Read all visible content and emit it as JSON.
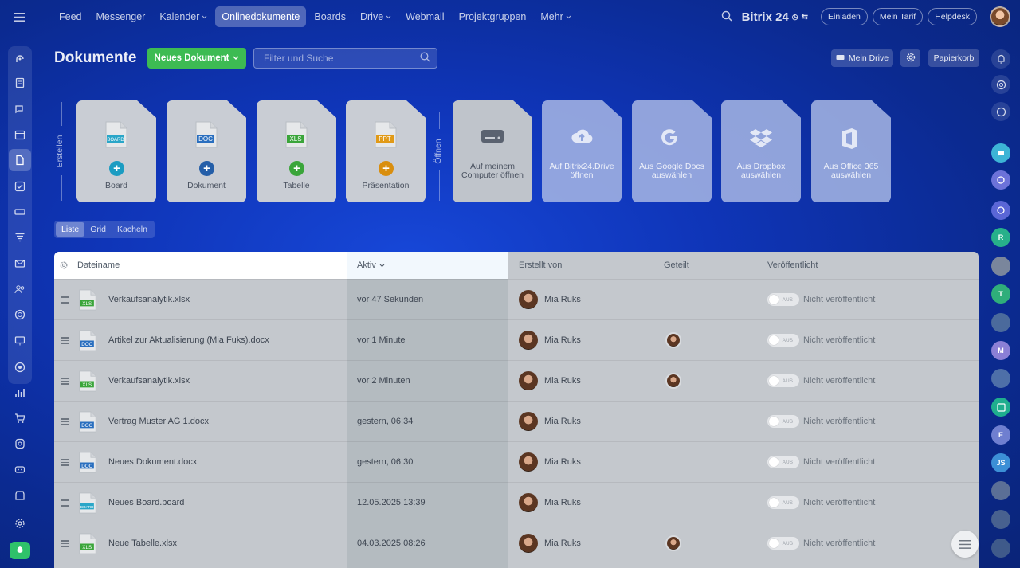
{
  "topbar": {
    "nav": [
      {
        "label": "Feed",
        "active": false,
        "dropdown": false
      },
      {
        "label": "Messenger",
        "active": false,
        "dropdown": false
      },
      {
        "label": "Kalender",
        "active": false,
        "dropdown": true
      },
      {
        "label": "Onlinedokumente",
        "active": true,
        "dropdown": false
      },
      {
        "label": "Boards",
        "active": false,
        "dropdown": false
      },
      {
        "label": "Drive",
        "active": false,
        "dropdown": true
      },
      {
        "label": "Webmail",
        "active": false,
        "dropdown": false
      },
      {
        "label": "Projektgruppen",
        "active": false,
        "dropdown": false
      },
      {
        "label": "Mehr",
        "active": false,
        "dropdown": true
      }
    ],
    "brand": "Bitrix 24",
    "invite_label": "Einladen",
    "plan_label": "Mein Tarif",
    "help_label": "Helpdesk"
  },
  "header": {
    "title": "Dokumente",
    "new_doc_label": "Neues Dokument",
    "search_placeholder": "Filter und Suche",
    "my_drive_label": "Mein Drive",
    "trash_label": "Papierkorb"
  },
  "create": {
    "section_label": "Erstellen",
    "tiles": [
      {
        "label": "Board",
        "badge": "BOARD",
        "badge_color": "#2aa6c8",
        "plus_color": "#1b9cc2"
      },
      {
        "label": "Dokument",
        "badge": "DOC",
        "badge_color": "#2a6fbf",
        "plus_color": "#245ea8"
      },
      {
        "label": "Tabelle",
        "badge": "XLS",
        "badge_color": "#3aa53a",
        "plus_color": "#3aa53a"
      },
      {
        "label": "Präsentation",
        "badge": "PPT",
        "badge_color": "#e19a17",
        "plus_color": "#d98e0e"
      }
    ]
  },
  "open": {
    "section_label": "Öffnen",
    "tiles": [
      {
        "label": "Auf meinem Computer öffnen",
        "icon": "hard-drive-icon"
      },
      {
        "label": "Auf Bitrix24.Drive öffnen",
        "icon": "cloud-upload-icon"
      },
      {
        "label": "Aus Google Docs auswählen",
        "icon": "google-icon"
      },
      {
        "label": "Aus Dropbox auswählen",
        "icon": "dropbox-icon"
      },
      {
        "label": "Aus Office 365 auswählen",
        "icon": "office-icon"
      }
    ]
  },
  "view_switch": {
    "options": [
      "Liste",
      "Grid",
      "Kacheln"
    ],
    "selected": "Liste"
  },
  "table": {
    "columns": {
      "name": "Dateiname",
      "active": "Aktiv",
      "created_by": "Erstellt von",
      "shared": "Geteilt",
      "published": "Veröffentlicht"
    },
    "toggle_text": "AUS",
    "rows": [
      {
        "name": "Verkaufsanalytik.xlsx",
        "type": "XLS",
        "active": "vor 47 Sekunden",
        "creator": "Mia Ruks",
        "shared": false,
        "published": "Nicht veröffentlicht"
      },
      {
        "name": "Artikel zur Aktualisierung (Mia Fuks).docx",
        "type": "DOC",
        "active": "vor 1 Minute",
        "creator": "Mia Ruks",
        "shared": true,
        "published": "Nicht veröffentlicht"
      },
      {
        "name": "Verkaufsanalytik.xlsx",
        "type": "XLS",
        "active": "vor 2 Minuten",
        "creator": "Mia Ruks",
        "shared": true,
        "published": "Nicht veröffentlicht"
      },
      {
        "name": "Vertrag Muster AG 1.docx",
        "type": "DOC",
        "active": "gestern, 06:34",
        "creator": "Mia Ruks",
        "shared": false,
        "published": "Nicht veröffentlicht"
      },
      {
        "name": "Neues Dokument.docx",
        "type": "DOC",
        "active": "gestern, 06:30",
        "creator": "Mia Ruks",
        "shared": false,
        "published": "Nicht veröffentlicht"
      },
      {
        "name": "Neues Board.board",
        "type": "BOARD",
        "active": "12.05.2025 13:39",
        "creator": "Mia Ruks",
        "shared": false,
        "published": "Nicht veröffentlicht"
      },
      {
        "name": "Neue Tabelle.xlsx",
        "type": "XLS",
        "active": "04.03.2025 08:26",
        "creator": "Mia Ruks",
        "shared": true,
        "published": "Nicht veröffentlicht"
      }
    ]
  },
  "right_sidebar": {
    "letters": [
      "R",
      "T",
      "M",
      "E",
      "JS"
    ]
  },
  "colors": {
    "accent_green": "#3dbb53",
    "xls": "#3aa53a",
    "doc": "#2a6fbf",
    "board": "#2aa6c8"
  }
}
